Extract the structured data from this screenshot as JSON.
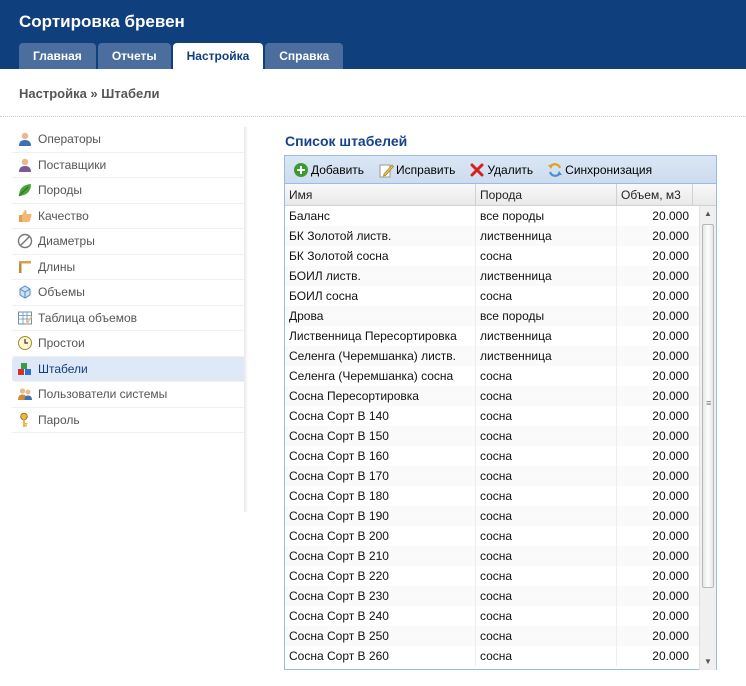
{
  "app": {
    "title": "Сортировка бревен"
  },
  "tabs": [
    {
      "label": "Главная",
      "active": false
    },
    {
      "label": "Отчеты",
      "active": false
    },
    {
      "label": "Настройка",
      "active": true
    },
    {
      "label": "Справка",
      "active": false
    }
  ],
  "breadcrumb": "Настройка » Штабели",
  "sidebar": {
    "items": [
      {
        "label": "Операторы",
        "icon": "user-icon"
      },
      {
        "label": "Поставщики",
        "icon": "supplier-icon"
      },
      {
        "label": "Породы",
        "icon": "leaf-icon"
      },
      {
        "label": "Качество",
        "icon": "thumbs-up-icon"
      },
      {
        "label": "Диаметры",
        "icon": "diameter-icon"
      },
      {
        "label": "Длины",
        "icon": "length-icon"
      },
      {
        "label": "Объемы",
        "icon": "cube-icon"
      },
      {
        "label": "Таблица объемов",
        "icon": "table-icon"
      },
      {
        "label": "Простои",
        "icon": "clock-icon"
      },
      {
        "label": "Штабели",
        "icon": "stacks-icon",
        "active": true
      },
      {
        "label": "Пользователи системы",
        "icon": "users-icon"
      },
      {
        "label": "Пароль",
        "icon": "key-icon"
      }
    ]
  },
  "panel": {
    "title": "Список штабелей",
    "toolbar": {
      "add": "Добавить",
      "edit": "Исправить",
      "delete": "Удалить",
      "sync": "Синхронизация"
    },
    "columns": [
      "Имя",
      "Порода",
      "Объем, м3"
    ],
    "rows": [
      [
        "Баланс",
        "все породы",
        "20.000"
      ],
      [
        "БК Золотой листв.",
        "лиственница",
        "20.000"
      ],
      [
        "БК Золотой сосна",
        "сосна",
        "20.000"
      ],
      [
        "БОИЛ листв.",
        "лиственница",
        "20.000"
      ],
      [
        "БОИЛ сосна",
        "сосна",
        "20.000"
      ],
      [
        "Дрова",
        "все породы",
        "20.000"
      ],
      [
        "Лиственница Пересортировка",
        "лиственница",
        "20.000"
      ],
      [
        "Селенга (Черемшанка) листв.",
        "лиственница",
        "20.000"
      ],
      [
        "Селенга (Черемшанка) сосна",
        "сосна",
        "20.000"
      ],
      [
        "Сосна Пересортировка",
        "сосна",
        "20.000"
      ],
      [
        "Сосна Сорт В 140",
        "сосна",
        "20.000"
      ],
      [
        "Сосна Сорт В 150",
        "сосна",
        "20.000"
      ],
      [
        "Сосна Сорт В 160",
        "сосна",
        "20.000"
      ],
      [
        "Сосна Сорт В 170",
        "сосна",
        "20.000"
      ],
      [
        "Сосна Сорт В 180",
        "сосна",
        "20.000"
      ],
      [
        "Сосна Сорт В 190",
        "сосна",
        "20.000"
      ],
      [
        "Сосна Сорт В 200",
        "сосна",
        "20.000"
      ],
      [
        "Сосна Сорт В 210",
        "сосна",
        "20.000"
      ],
      [
        "Сосна Сорт В 220",
        "сосна",
        "20.000"
      ],
      [
        "Сосна Сорт В 230",
        "сосна",
        "20.000"
      ],
      [
        "Сосна Сорт В 240",
        "сосна",
        "20.000"
      ],
      [
        "Сосна Сорт В 250",
        "сосна",
        "20.000"
      ],
      [
        "Сосна Сорт В 260",
        "сосна",
        "20.000"
      ]
    ]
  },
  "colors": {
    "header": "#0f3f7d",
    "accent": "#15428b",
    "active_row": "#dfe8f6"
  }
}
